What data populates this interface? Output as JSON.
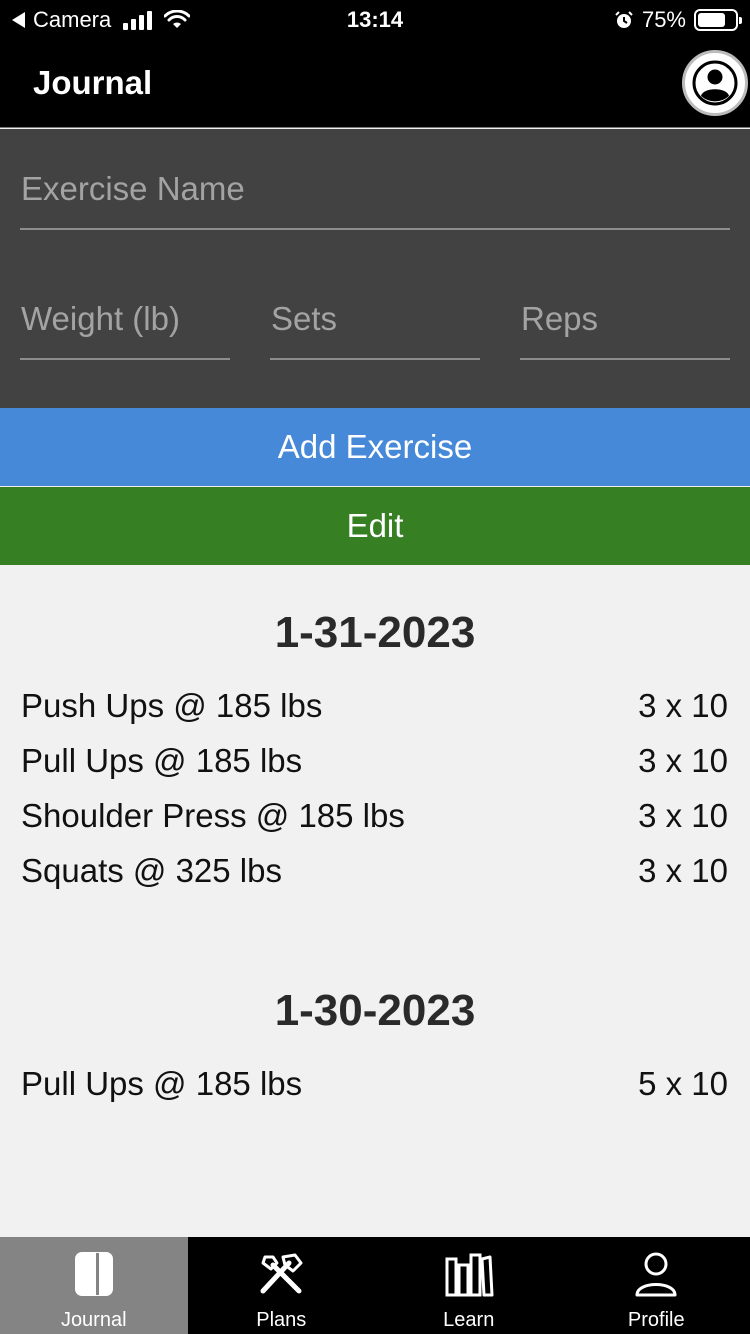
{
  "status_bar": {
    "back_label": "Camera",
    "time": "13:14",
    "battery": "75%",
    "battery_level": 0.75
  },
  "header": {
    "title": "Journal",
    "avatar_icon": "user-circle-icon"
  },
  "form": {
    "exercise_placeholder": "Exercise Name",
    "weight_placeholder": "Weight (lb)",
    "sets_placeholder": "Sets",
    "reps_placeholder": "Reps"
  },
  "buttons": {
    "add_label": "Add Exercise",
    "edit_label": "Edit",
    "add_color": "#4589d8",
    "edit_color": "#367f23"
  },
  "days": [
    {
      "date": "1-31-2023",
      "entries": [
        {
          "name": "Push Ups @ 185 lbs",
          "sets_reps": "3 x 10"
        },
        {
          "name": "Pull Ups @ 185 lbs",
          "sets_reps": "3 x 10"
        },
        {
          "name": "Shoulder Press @ 185 lbs",
          "sets_reps": "3 x 10"
        },
        {
          "name": "Squats @ 325 lbs",
          "sets_reps": "3 x 10"
        }
      ]
    },
    {
      "date": "1-30-2023",
      "entries": [
        {
          "name": "Pull Ups @ 185 lbs",
          "sets_reps": "5 x 10"
        }
      ]
    }
  ],
  "tabs": [
    {
      "label": "Journal",
      "icon": "journal-icon",
      "active": true
    },
    {
      "label": "Plans",
      "icon": "tools-icon",
      "active": false
    },
    {
      "label": "Learn",
      "icon": "books-icon",
      "active": false
    },
    {
      "label": "Profile",
      "icon": "person-icon",
      "active": false
    }
  ]
}
